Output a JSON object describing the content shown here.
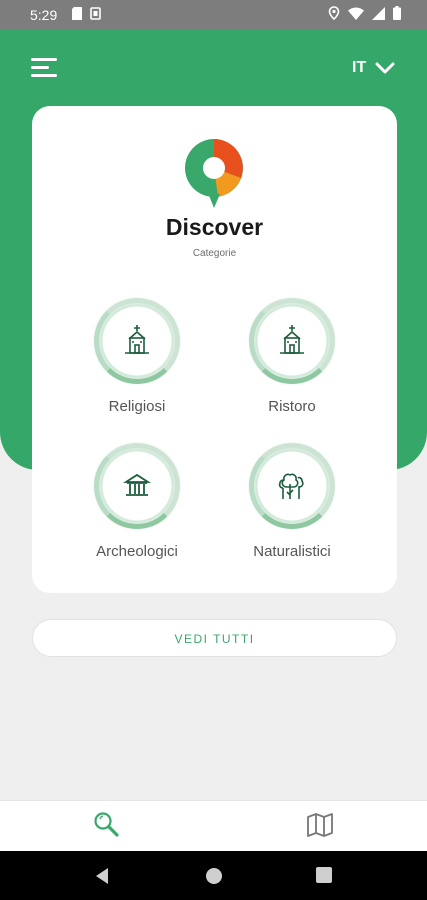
{
  "status_bar": {
    "time": "5:29",
    "left_icons": [
      "sd-card-icon",
      "sim-icon"
    ],
    "right_icons": [
      "location-icon",
      "wifi-icon",
      "signal-icon",
      "battery-icon"
    ]
  },
  "header": {
    "menu_icon": "hamburger-menu-icon",
    "language": "IT",
    "language_icon": "chevron-down-icon"
  },
  "card": {
    "title": "Discover",
    "subtitle": "Categorie",
    "categories": [
      {
        "label": "Religiosi",
        "icon": "church-icon"
      },
      {
        "label": "Ristoro",
        "icon": "church-icon"
      },
      {
        "label": "Archeologici",
        "icon": "temple-icon"
      },
      {
        "label": "Naturalistici",
        "icon": "trees-icon"
      }
    ]
  },
  "see_all": {
    "label": "VEDI TUTTI"
  },
  "bottom_nav": {
    "tabs": [
      {
        "icon": "search-icon",
        "active": true
      },
      {
        "icon": "map-icon",
        "active": false
      }
    ]
  },
  "system_nav": [
    "back-icon",
    "home-icon",
    "recents-icon"
  ],
  "colors": {
    "primary_green": "#35a768",
    "logo_green": "#3aa86b",
    "logo_orange": "#f29a1f",
    "logo_red": "#e8501e",
    "status_bar": "#7d7d7d"
  }
}
